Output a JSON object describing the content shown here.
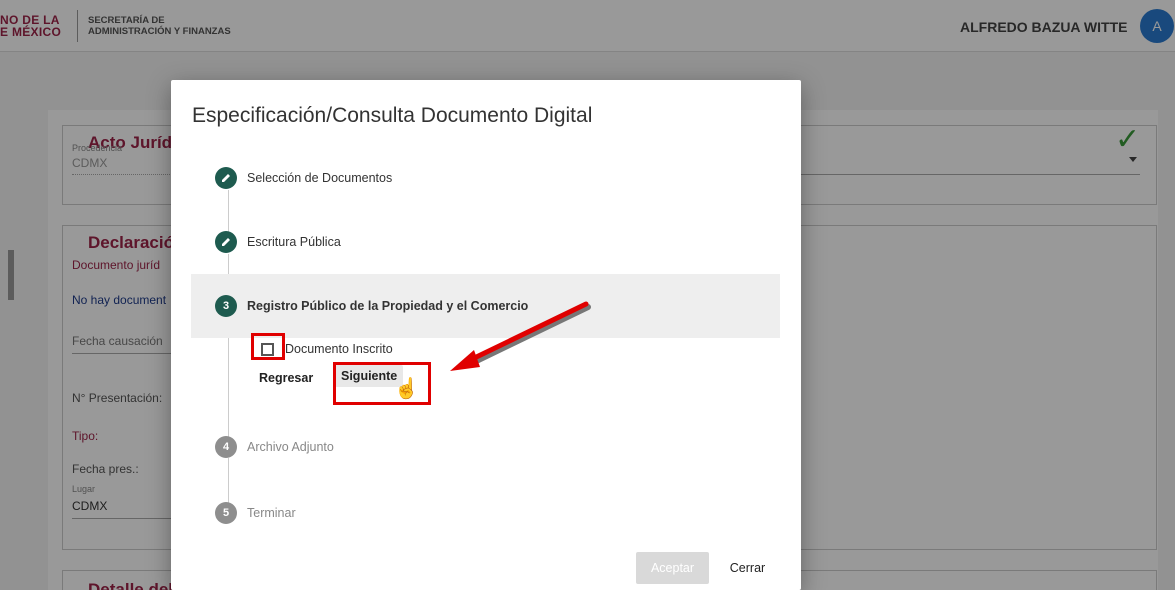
{
  "header": {
    "logo_line1": "NO DE LA",
    "logo_line2": "E MÉXICO",
    "secretaria_line1": "SECRETARÍA DE",
    "secretaria_line2": "ADMINISTRACIÓN Y FINANZAS",
    "user_name": "ALFREDO BAZUA WITTE",
    "avatar_initial": "A"
  },
  "background": {
    "acto_title": "Acto Juríd",
    "procedencia_label": "Procedencia",
    "procedencia_value": "CDMX",
    "declaracion_title": "Declaració",
    "documento_juridico": "Documento juríd",
    "no_hay_documentos": "No hay document",
    "fecha_causacion": "Fecha causación",
    "n_presentacion": "N° Presentación:",
    "tipo": "Tipo:",
    "fecha_pres": "Fecha pres.:",
    "lugar_label": "Lugar",
    "lugar_value": "CDMX",
    "detalle_title": "Detalle del"
  },
  "modal": {
    "title": "Especificación/Consulta Documento Digital",
    "steps": [
      {
        "number": "",
        "icon": "pencil-icon",
        "label": "Selección de Documentos",
        "state": "completed"
      },
      {
        "number": "",
        "icon": "pencil-icon",
        "label": "Escritura Pública",
        "state": "completed"
      },
      {
        "number": "3",
        "icon": "",
        "label": "Registro Público de la Propiedad y el Comercio",
        "state": "active"
      },
      {
        "number": "4",
        "icon": "",
        "label": "Archivo Adjunto",
        "state": "inactive"
      },
      {
        "number": "5",
        "icon": "",
        "label": "Terminar",
        "state": "inactive"
      }
    ],
    "checkbox_label": "Documento Inscrito",
    "checkbox_checked": false,
    "btn_regresar": "Regresar",
    "btn_siguiente": "Siguiente",
    "btn_aceptar": "Aceptar",
    "btn_cerrar": "Cerrar"
  },
  "colors": {
    "brand": "#9d2449",
    "step_active": "#1e5b4f",
    "annotation": "#e00000",
    "avatar": "#2a7bd1"
  }
}
